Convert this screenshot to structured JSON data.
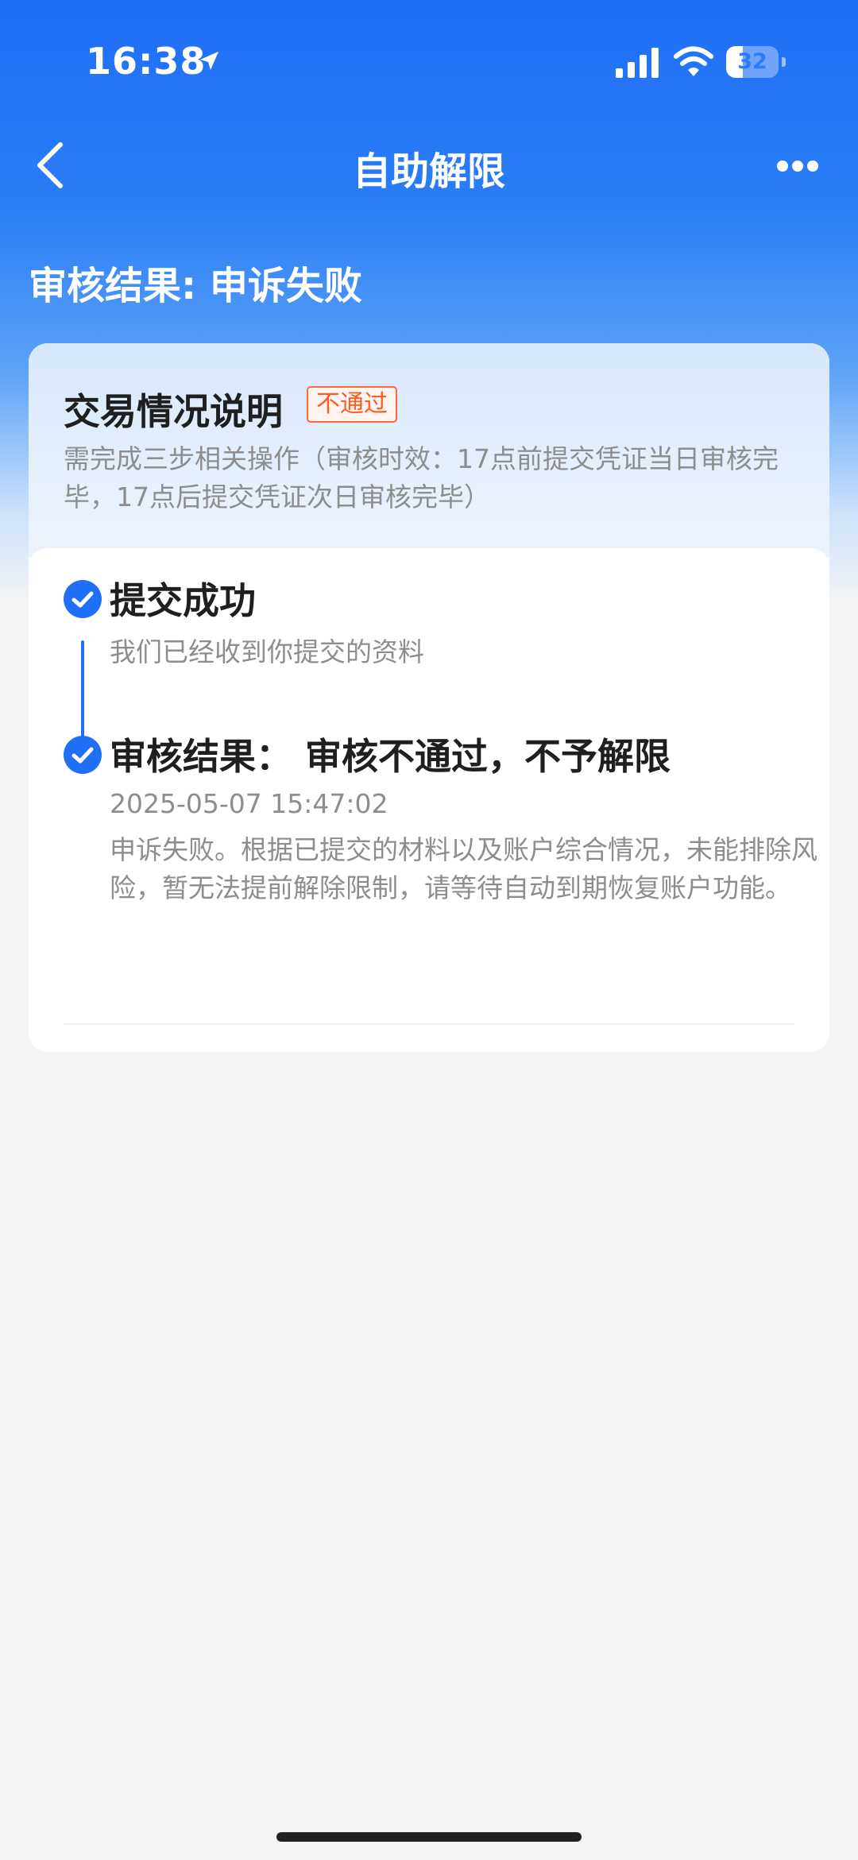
{
  "status_bar": {
    "time": "16:38",
    "battery_level": "32",
    "battery_fraction": 0.32,
    "icons": [
      "location-arrow-icon",
      "cellular-signal-icon",
      "wifi-icon",
      "battery-icon"
    ]
  },
  "nav": {
    "title": "自助解限",
    "back_icon": "chevron-left-icon",
    "more_icon": "more-dots-icon"
  },
  "result_heading": "审核结果: 申诉失败",
  "card": {
    "title": "交易情况说明",
    "badge": "不通过",
    "description": "需完成三步相关操作（审核时效：17点前提交凭证当日审核完毕，17点后提交凭证次日审核完毕）",
    "steps": [
      {
        "title": "提交成功",
        "text": "我们已经收到你提交的资料",
        "icon": "check-circle-icon"
      },
      {
        "title": "审核结果：  审核不通过，不予解限",
        "timestamp": "2025-05-07 15:47:02",
        "text": "申诉失败。根据已提交的材料以及账户综合情况，未能排除风险，暂无法提前解除限制，请等待自动到期恢复账户功能。",
        "icon": "check-circle-icon"
      }
    ]
  },
  "colors": {
    "primary": "#1f6ff7",
    "badge": "#ff5a22",
    "background": "#f4f4f5"
  }
}
